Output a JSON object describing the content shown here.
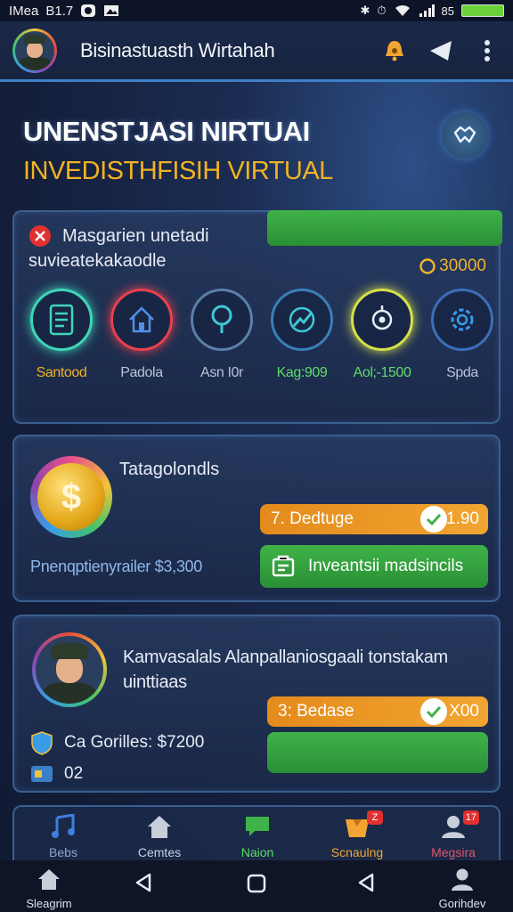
{
  "status_bar": {
    "carrier": "IMea",
    "time": "B1.7",
    "right_text": "85"
  },
  "app_bar": {
    "title": "Bisinastuasth Wirtahah"
  },
  "hero": {
    "title": "UNENSTJASI NIRTUAI",
    "subtitle": "INVEDISTHFISIH VIRTUAL"
  },
  "card1": {
    "header": "Masgarien unetadi",
    "sub": "suvieatekakaodle",
    "amount": "30000",
    "features": [
      {
        "label": "Santood",
        "icon": "document-icon",
        "color": "#3fd6b8",
        "label_color": "#f2b322"
      },
      {
        "label": "Padola",
        "icon": "home-icon",
        "color": "#e8414f",
        "label_color": "#b9c3d8"
      },
      {
        "label": "Asn I0r",
        "icon": "location-pin-icon",
        "color": "#3fc7d6",
        "label_color": "#b9c3d8"
      },
      {
        "label": "Kag:909",
        "icon": "graph-icon",
        "color": "#3fa0d6",
        "label_color": "#5fdc6a"
      },
      {
        "label": "Aol;-1500",
        "icon": "target-icon",
        "color": "#d6e04a",
        "label_color": "#5fdc6a"
      },
      {
        "label": "Spda",
        "icon": "gear-icon",
        "color": "#3a7fd6",
        "label_color": "#b9c3d8"
      }
    ]
  },
  "card2": {
    "title": "Tatagolondls",
    "note": "Pnenqptienyrailer $3,300",
    "pill_label": "7. Dedtuge",
    "pill_value": "1.90",
    "button_label": "Inveantsii madsincils"
  },
  "card3": {
    "title": "Kamvasalals Alanpallaniosgaali tonstakam uinttiaas",
    "line1": "Ca Gorilles: $7200",
    "line2": "02",
    "pill_label": "3: Bedase",
    "pill_value": "X00"
  },
  "bottom_tabs": [
    {
      "label": "Bebs",
      "icon": "music-icon",
      "color": "#3d7fe0",
      "label_color": "#8ea4c9"
    },
    {
      "label": "Cemtes",
      "icon": "home-icon",
      "color": "#c9cfda",
      "label_color": "#c9cfda"
    },
    {
      "label": "Naion",
      "icon": "chat-icon",
      "color": "#3fb248",
      "label_color": "#5fdc6a"
    },
    {
      "label": "Scnaulng",
      "icon": "gift-icon",
      "color": "#f2a531",
      "label_color": "#f2a531",
      "badge": "Z"
    },
    {
      "label": "Megsira",
      "icon": "person-icon",
      "color": "#c9cfda",
      "label_color": "#e0546a",
      "badge": "17"
    }
  ],
  "nav_bar": {
    "left_label": "Sleagrim",
    "right_label": "Gorihdev"
  }
}
